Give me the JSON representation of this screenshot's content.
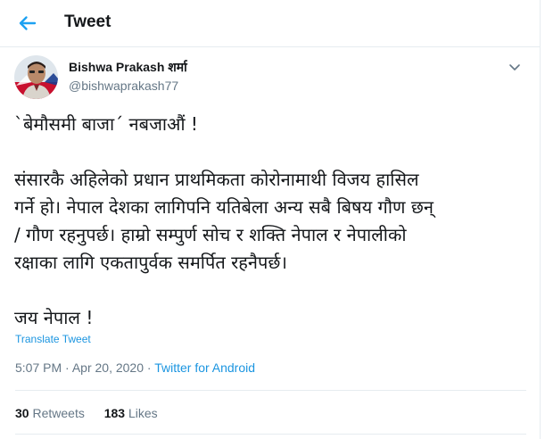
{
  "header": {
    "title": "Tweet",
    "back_icon": "arrow-left-icon"
  },
  "author": {
    "name": "Bishwa Prakash शर्मा",
    "handle": "@bishwaprakash77",
    "avatar_icon": "profile-photo"
  },
  "menu_icon": "chevron-down-icon",
  "tweet": {
    "lines_1": [
      "`बेमौसमी बाजा´ नबजाऔं !"
    ],
    "lines_2": [
      "संसारकै अहिलेको प्रधान प्राथमिकता कोरोनामाथी विजय हासिल",
      "गर्ने हो। नेपाल देशका लागिपनि यतिबेला अन्य सबै बिषय गौण छन्",
      "/ गौण रहनुपर्छ। हाम्रो सम्पुर्ण सोच र शक्ति नेपाल र नेपालीको",
      "रक्षाका लागि एकतापुर्वक समर्पित रहनैपर्छ।"
    ],
    "lines_3": [
      "जय नेपाल !"
    ]
  },
  "translate_label": "Translate Tweet",
  "meta": {
    "time": "5:07 PM",
    "separator": "·",
    "date": "Apr 20, 2020",
    "source": "Twitter for Android"
  },
  "stats": {
    "retweets_count": "30",
    "retweets_label": "Retweets",
    "likes_count": "183",
    "likes_label": "Likes"
  },
  "colors": {
    "accent": "#1da1f2",
    "link": "#1b95e0",
    "muted": "#657786",
    "border": "#e6ecf0"
  }
}
